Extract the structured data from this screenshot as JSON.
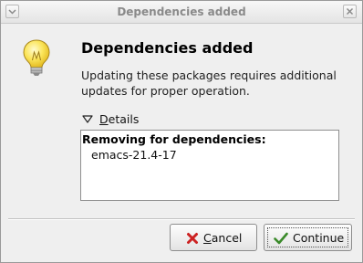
{
  "window": {
    "title": "Dependencies added"
  },
  "dialog": {
    "icon": "lightbulb-icon",
    "heading": "Dependencies added",
    "message": "Updating these packages requires additional updates for proper operation."
  },
  "details": {
    "expander_icon": "triangle-down-icon",
    "label_mnemonic": "D",
    "label_rest": "etails",
    "heading": "Removing for dependencies:",
    "items": [
      "emacs-21.4-17"
    ]
  },
  "buttons": {
    "cancel": {
      "icon": "cancel-x-icon",
      "mnemonic": "C",
      "label_rest": "ancel",
      "icon_color": "#cc2222"
    },
    "continue": {
      "icon": "checkmark-icon",
      "label": "Continue",
      "icon_color": "#3a8a2a"
    }
  }
}
